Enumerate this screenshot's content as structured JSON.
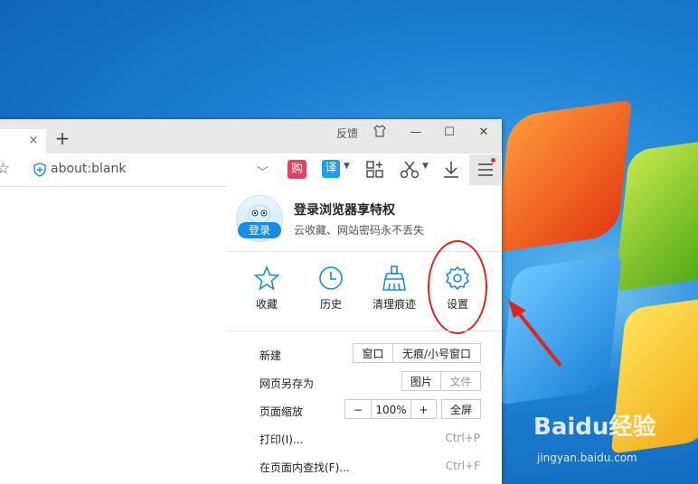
{
  "browser": {
    "titlebar": {
      "tab_close": "×",
      "new_tab": "+",
      "feedback": "反馈",
      "minimize": "—",
      "maximize": "☐",
      "close": "✕"
    },
    "toolbar": {
      "address": "about:blank",
      "buy_label": "购",
      "translate_label": "译"
    }
  },
  "menu": {
    "login": {
      "badge": "登录",
      "title": "登录浏览器享特权",
      "subtitle": "云收藏、网站密码永不丢失"
    },
    "quick_actions": [
      {
        "label": "收藏",
        "icon": "star-icon"
      },
      {
        "label": "历史",
        "icon": "clock-icon"
      },
      {
        "label": "清理痕迹",
        "icon": "broom-icon"
      },
      {
        "label": "设置",
        "icon": "gear-icon"
      }
    ],
    "new": {
      "label": "新建",
      "window": "窗口",
      "private_window": "无痕/小号窗口"
    },
    "save_as": {
      "label": "网页另存为",
      "image": "图片",
      "file": "文件"
    },
    "zoom": {
      "label": "页面缩放",
      "minus": "−",
      "value": "100%",
      "plus": "+",
      "fullscreen": "全屏"
    },
    "print": {
      "label": "打印(I)...",
      "shortcut": "Ctrl+P"
    },
    "find": {
      "label": "在页面内查找(F)...",
      "shortcut": "Ctrl+F"
    }
  },
  "watermark": {
    "brand": "Baidu经验",
    "url": "jingyan.baidu.com"
  },
  "colors": {
    "accent": "#1a8be5",
    "annotation_red": "#e2231a"
  }
}
